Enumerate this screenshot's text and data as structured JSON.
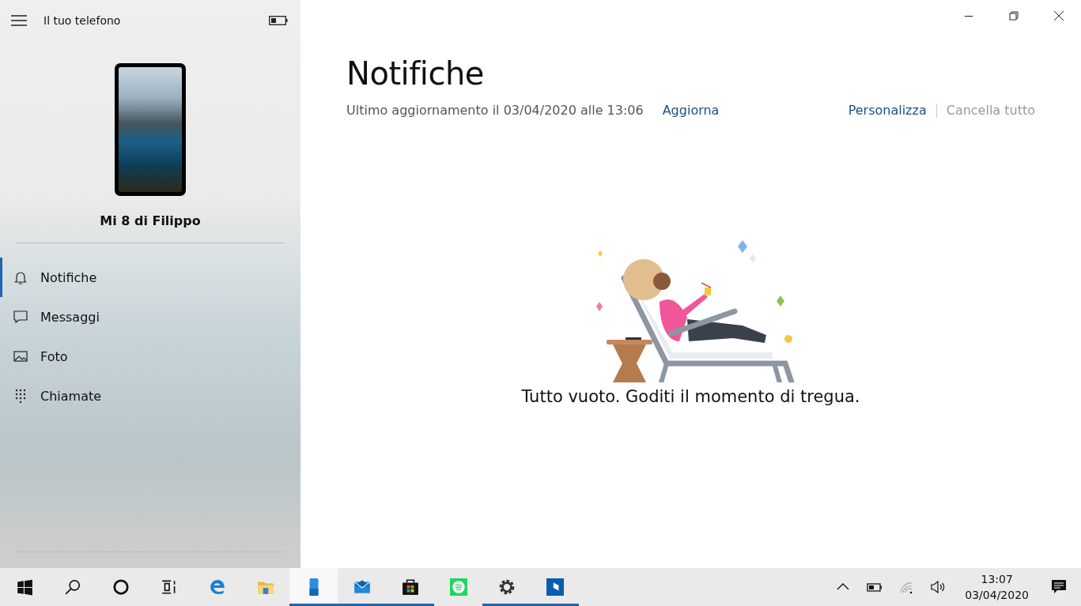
{
  "sidebar": {
    "title": "Il tuo telefono",
    "device_name": "Mi 8 di Filippo",
    "items": [
      {
        "kind": "bell",
        "label": "Notifiche",
        "selected": true
      },
      {
        "kind": "message",
        "label": "Messaggi",
        "selected": false
      },
      {
        "kind": "photo",
        "label": "Foto",
        "selected": false
      },
      {
        "kind": "dialpad",
        "label": "Chiamate",
        "selected": false
      }
    ]
  },
  "window_controls": [
    {
      "kind": "minimize"
    },
    {
      "kind": "restore"
    },
    {
      "kind": "close"
    }
  ],
  "main": {
    "title": "Notifiche",
    "last_update": "Ultimo aggiornamento il 03/04/2020 alle 13:06",
    "refresh": "Aggiorna",
    "actions": [
      {
        "label": "Personalizza",
        "disabled": false
      },
      {
        "label": "Cancella tutto",
        "disabled": true
      }
    ],
    "empty_message": "Tutto vuoto. Goditi il momento di tregua."
  },
  "taskbar": {
    "items": [
      {
        "kind": "start",
        "running": false,
        "selected": false
      },
      {
        "kind": "search",
        "running": false,
        "selected": false
      },
      {
        "kind": "cortana",
        "running": false,
        "selected": false
      },
      {
        "kind": "taskview",
        "running": false,
        "selected": false
      },
      {
        "kind": "edge",
        "running": false,
        "selected": false
      },
      {
        "kind": "folder",
        "running": false,
        "selected": false
      },
      {
        "kind": "phone",
        "running": true,
        "selected": true
      },
      {
        "kind": "mail",
        "running": true,
        "selected": false
      },
      {
        "kind": "store",
        "running": true,
        "selected": false
      },
      {
        "kind": "spotify",
        "running": false,
        "selected": false
      },
      {
        "kind": "settings",
        "running": true,
        "selected": false
      },
      {
        "kind": "app",
        "running": true,
        "selected": false
      }
    ],
    "tray": [
      {
        "kind": "chevron"
      },
      {
        "kind": "battery"
      },
      {
        "kind": "wifi"
      },
      {
        "kind": "volume"
      }
    ],
    "time": "13:07",
    "date": "03/04/2020"
  }
}
